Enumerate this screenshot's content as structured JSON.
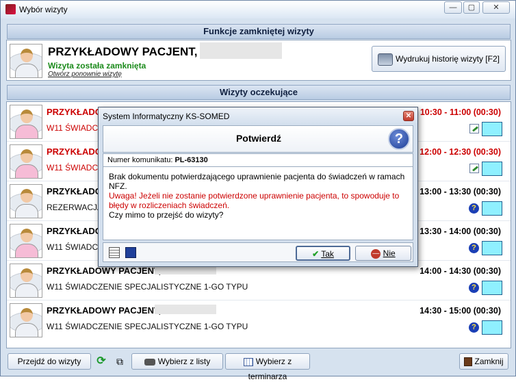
{
  "window": {
    "title": "Wybór wizyty"
  },
  "closed_visit": {
    "header": "Funkcje zamkniętej wizyty",
    "patient_name": "PRZYKŁADOWY PACJENT,",
    "status": "Wizyta została zamknięta",
    "reopen_link": "Otwórz ponownie wizytę",
    "print_button": "Wydrukuj historię wizyty [F2]"
  },
  "waiting": {
    "header": "Wizyty oczekujące",
    "rows": [
      {
        "name": "PRZYKŁADO",
        "service": "W11 ŚWIADCZ",
        "time": "10:30 - 11:00 (00:30)",
        "color": "#cc0000",
        "avatar": "pink",
        "icon": "edit-icon"
      },
      {
        "name": "PRZYKŁADO",
        "service": "W11 ŚWIADCZ",
        "time": "12:00 - 12:30 (00:30)",
        "color": "#cc0000",
        "avatar": "pink",
        "icon": "edit-icon"
      },
      {
        "name": "PRZYKŁADO",
        "service": "REZERWACJA",
        "time": "13:00 - 13:30 (00:30)",
        "color": "#000000",
        "avatar": "grey",
        "icon": "question-icon"
      },
      {
        "name": "PRZYKŁADO",
        "service": "W11 ŚWIADCZ",
        "time": "13:30 - 14:00 (00:30)",
        "color": "#000000",
        "avatar": "pink",
        "icon": "question-icon"
      },
      {
        "name": "PRZYKŁADOWY PACJENT,",
        "service": "W11 ŚWIADCZENIE SPECJALISTYCZNE 1-GO TYPU",
        "time": "14:00 - 14:30 (00:30)",
        "color": "#000000",
        "avatar": "grey",
        "icon": "question-icon"
      },
      {
        "name": "PRZYKŁADOWY PACJENT,",
        "service": "W11 ŚWIADCZENIE SPECJALISTYCZNE 1-GO TYPU",
        "time": "14:30 - 15:00 (00:30)",
        "color": "#000000",
        "avatar": "grey",
        "icon": "question-icon"
      }
    ]
  },
  "toolbar": {
    "go_to_visit": "Przejdź do wizyty",
    "choose_from_list": "Wybierz z listy",
    "choose_from_schedule": "Wybierz z terminarza",
    "close": "Zamknij"
  },
  "dialog": {
    "title": "System Informatyczny KS-SOMED",
    "header": "Potwierdź",
    "number_label": "Numer komunikatu:",
    "number_value": "PL-63130",
    "line1": "Brak dokumentu potwierdzającego uprawnienie pacjenta do świadczeń w ramach NFZ.",
    "warning": "Uwaga! Jeżeli nie zostanie potwierdzone uprawnienie pacjenta, to spowoduje to błędy w rozliczeniach świadczeń.",
    "question": "Czy mimo to przejść do wizyty?",
    "yes": "Tak",
    "no": "Nie",
    "warning_color": "#cc0000"
  }
}
